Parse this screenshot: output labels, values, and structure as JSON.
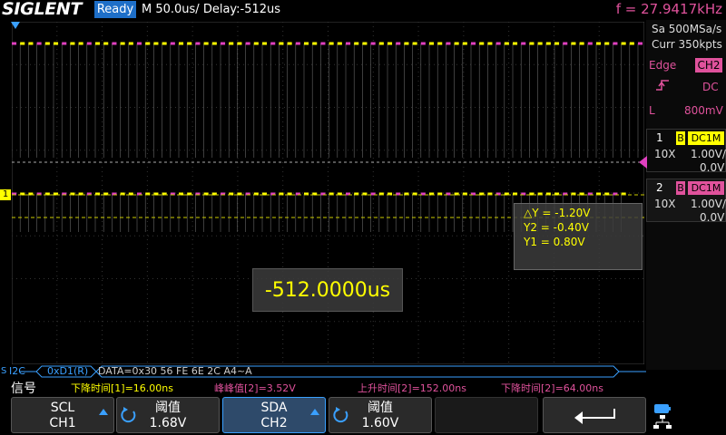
{
  "topbar": {
    "logo": "SIGLENT",
    "status": "Ready",
    "timebase": "M 50.0us/  Delay:-512us",
    "frequency": "f = 27.9417kHz"
  },
  "acquisition": {
    "sample_rate": "Sa 500MSa/s",
    "memory": "Curr 350kpts"
  },
  "trigger": {
    "type_label": "Edge",
    "source": "CH2",
    "coupling": "DC",
    "level_label": "L",
    "level": "800mV"
  },
  "channels": [
    {
      "num": "1",
      "bw": "B",
      "coupling": "DC1M",
      "probe": "10X",
      "scale": "1.00V/",
      "offset": "0.0V",
      "color": "#ffff00"
    },
    {
      "num": "2",
      "bw": "B",
      "coupling": "DC1M",
      "probe": "10X",
      "scale": "1.00V/",
      "offset": "0.0V",
      "color": "#e0529c"
    }
  ],
  "cursor": {
    "dy": "△Y = -1.20V",
    "y2": "Y2 = -0.40V",
    "y1": "Y1 = 0.80V"
  },
  "delay_popup": "-512.0000us",
  "decode": {
    "bus": "I2C",
    "address": "0xD1(R)",
    "data": "DATA=0x30 56 FE 6E 2C A4~A"
  },
  "measurements": {
    "label": "信号",
    "items": [
      {
        "text": "下降时间[1]=16.00ns",
        "color": "#ffff00"
      },
      {
        "text": "峰峰值[2]=3.52V",
        "color": "#e0529c"
      },
      {
        "text": "上升时间[2]=152.00ns",
        "color": "#e0529c"
      },
      {
        "text": "下降时间[2]=64.00ns",
        "color": "#e0529c"
      }
    ]
  },
  "softkeys": {
    "scl_top": "SCL",
    "scl_bottom": "CH1",
    "thresh1_top": "阈值",
    "thresh1_value": "1.68V",
    "sda_top": "SDA",
    "sda_bottom": "CH2",
    "thresh2_top": "阈值",
    "thresh2_value": "1.60V"
  },
  "markers": {
    "ch1_marker": "1",
    "bus_marker": "S"
  },
  "colors": {
    "ch1": "#ffff00",
    "ch2": "#e0529c",
    "accent": "#1e6fc8",
    "trigger_marker": "#e040c0"
  }
}
